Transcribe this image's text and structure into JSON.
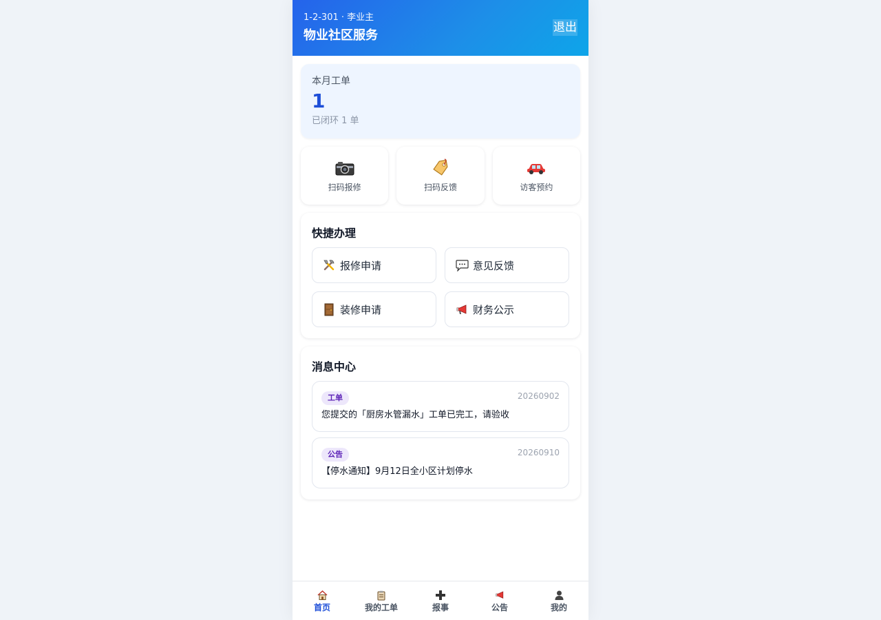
{
  "header": {
    "subtitle": "1-2-301 · 李业主",
    "title": "物业社区服务",
    "logout_label": "退出"
  },
  "stats": {
    "label": "本月工单",
    "value": "1",
    "note": "已闭环 1 单"
  },
  "actions": [
    {
      "label": "扫码报修",
      "icon": "camera-icon"
    },
    {
      "label": "扫码反馈",
      "icon": "tag-icon"
    },
    {
      "label": "访客预约",
      "icon": "car-icon"
    }
  ],
  "quick": {
    "title": "快捷办理",
    "items": [
      {
        "label": "报修申请",
        "icon": "tools-icon"
      },
      {
        "label": "意见反馈",
        "icon": "speech-bubble-icon"
      },
      {
        "label": "装修申请",
        "icon": "door-icon"
      },
      {
        "label": "财务公示",
        "icon": "megaphone-icon"
      }
    ]
  },
  "messages": {
    "title": "消息中心",
    "items": [
      {
        "tag": "工单",
        "date": "20260902",
        "text": "您提交的「厨房水管漏水」工单已完工，请验收"
      },
      {
        "tag": "公告",
        "date": "20260910",
        "text": "【停水通知】9月12日全小区计划停水"
      }
    ]
  },
  "tabbar": {
    "active": "首页",
    "items": [
      {
        "label": "首页",
        "icon": "home-icon"
      },
      {
        "label": "我的工单",
        "icon": "clipboard-icon"
      },
      {
        "label": "报事",
        "icon": "plus-icon"
      },
      {
        "label": "公告",
        "icon": "megaphone-icon"
      },
      {
        "label": "我的",
        "icon": "user-icon"
      }
    ]
  },
  "colors": {
    "accent": "#1d4ed8",
    "header_gradient_start": "#2563eb",
    "header_gradient_end": "#0ea5e9",
    "tag_bg": "#ede7fb",
    "tag_text": "#5b21b6"
  }
}
